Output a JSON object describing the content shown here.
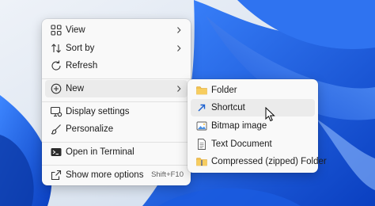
{
  "context_menu": {
    "items": [
      {
        "label": "View"
      },
      {
        "label": "Sort by"
      },
      {
        "label": "Refresh"
      },
      {
        "label": "New"
      },
      {
        "label": "Display settings"
      },
      {
        "label": "Personalize"
      },
      {
        "label": "Open in Terminal"
      },
      {
        "label": "Show more options",
        "shortcut": "Shift+F10"
      }
    ]
  },
  "new_submenu": {
    "items": [
      {
        "label": "Folder",
        "icon": "folder-icon"
      },
      {
        "label": "Shortcut",
        "icon": "shortcut-arrow-icon"
      },
      {
        "label": "Bitmap image",
        "icon": "bitmap-image-icon"
      },
      {
        "label": "Text Document",
        "icon": "text-document-icon"
      },
      {
        "label": "Compressed (zipped) Folder",
        "icon": "zipped-folder-icon"
      }
    ]
  },
  "colors": {
    "wallpaper_light": "#e2e9f3",
    "wallpaper_blue": "#1f63e0",
    "menu_background": "#f9f9f9",
    "highlight": "#ebebeb",
    "folder_yellow": "#f2c14e"
  }
}
